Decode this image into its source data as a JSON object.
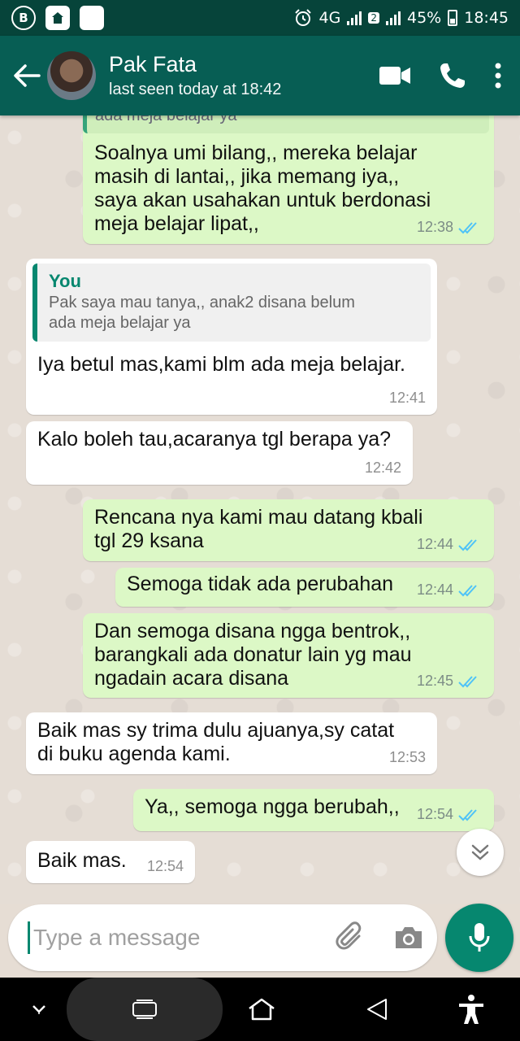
{
  "status_bar": {
    "network": "4G",
    "sim_slot": "2",
    "battery": "45%",
    "time": "18:45"
  },
  "header": {
    "contact_name": "Pak Fata",
    "last_seen": "last seen today at 18:42"
  },
  "quote_fragment": "ada meja belajar ya",
  "messages": [
    {
      "dir": "out",
      "text": "Soalnya umi bilang,, mereka belajar\nmasih di lantai,, jika memang iya,,\nsaya akan usahakan untuk berdonasi\nmeja belajar lipat,,",
      "time": "12:38"
    },
    {
      "dir": "in",
      "quote_name": "You",
      "quote_text": "Pak saya mau tanya,, anak2 disana belum\nada meja belajar ya",
      "text": "Iya betul mas,kami blm ada meja belajar.",
      "time": "12:41"
    },
    {
      "dir": "in",
      "text": "Kalo boleh tau,acaranya tgl berapa ya?",
      "time": "12:42"
    },
    {
      "dir": "out",
      "text": "Rencana nya kami mau datang kbali\ntgl 29 ksana",
      "time": "12:44"
    },
    {
      "dir": "out",
      "text": "Semoga tidak ada perubahan",
      "time": "12:44"
    },
    {
      "dir": "out",
      "text": "Dan semoga disana ngga bentrok,,\nbarangkali ada donatur lain yg mau\nngadain acara disana",
      "time": "12:45"
    },
    {
      "dir": "in",
      "text": "Baik mas sy trima dulu ajuanya,sy catat\ndi buku agenda kami.",
      "time": "12:53"
    },
    {
      "dir": "out",
      "text": "Ya,, semoga ngga berubah,,",
      "time": "12:54"
    },
    {
      "dir": "in",
      "text": "Baik mas.",
      "time": "12:54"
    }
  ],
  "input": {
    "placeholder": "Type a message"
  },
  "colors": {
    "header": "#075e54",
    "accent": "#06876f",
    "outgoing_bubble": "#dcf8c6",
    "read_ticks": "#4fc3f7"
  }
}
